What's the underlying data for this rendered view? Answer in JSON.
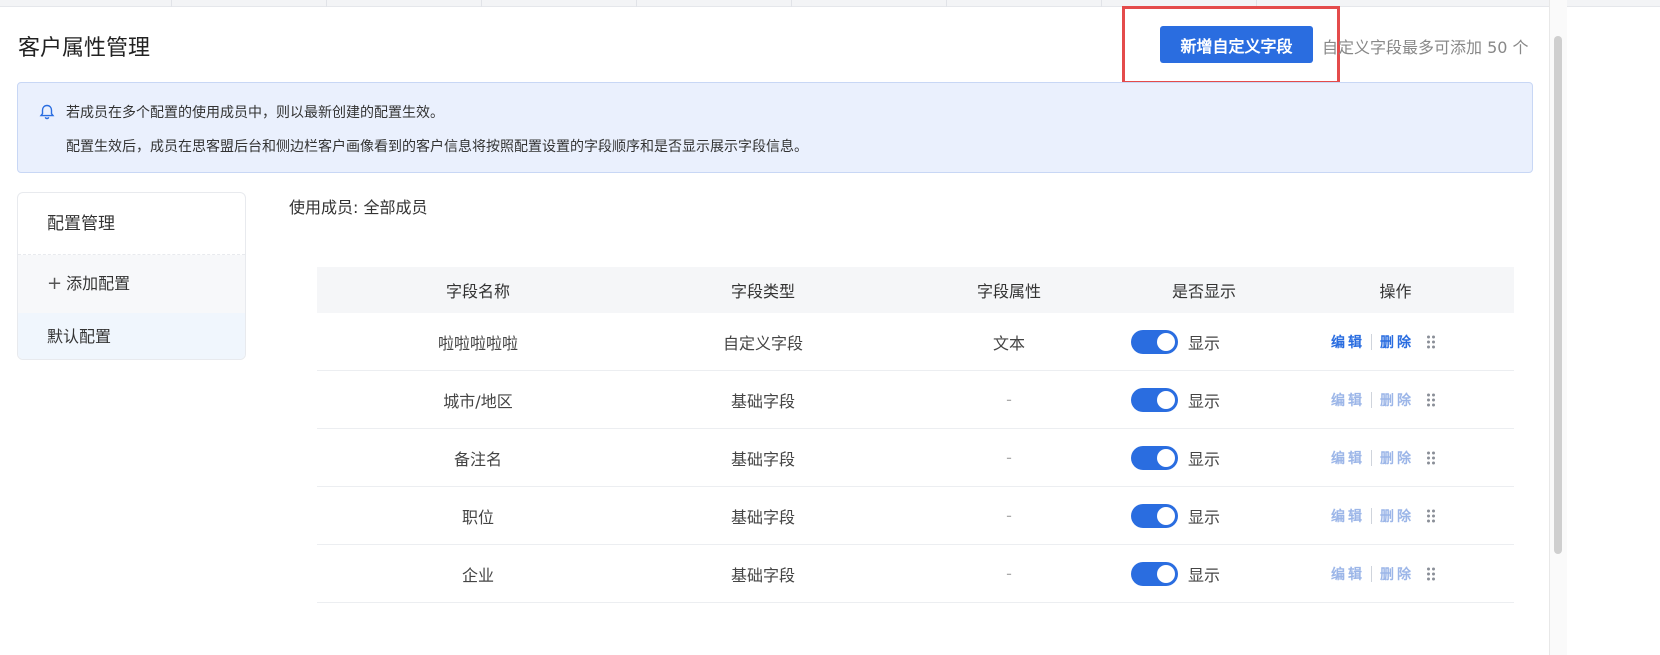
{
  "header": {
    "title": "客户属性管理",
    "add_button": "新增自定义字段",
    "limit_text": "自定义字段最多可添加 50 个"
  },
  "notice": {
    "icon": "bell-icon",
    "line1": "若成员在多个配置的使用成员中，则以最新创建的配置生效。",
    "line2": "配置生效后，成员在思客盟后台和侧边栏客户画像看到的客户信息将按照配置设置的字段顺序和是否显示展示字段信息。"
  },
  "sidebar": {
    "heading": "配置管理",
    "add_label": "添加配置",
    "items": [
      {
        "label": "默认配置"
      }
    ]
  },
  "members": "使用成员: 全部成员",
  "table": {
    "columns": [
      "字段名称",
      "字段类型",
      "字段属性",
      "是否显示",
      "操作"
    ],
    "rows": [
      {
        "name": "啦啦啦啦啦",
        "type": "自定义字段",
        "attr": "文本",
        "show": true,
        "show_label": "显示",
        "edit": "编辑",
        "delete": "删除",
        "editable": true
      },
      {
        "name": "城市/地区",
        "type": "基础字段",
        "attr": "-",
        "show": true,
        "show_label": "显示",
        "edit": "编辑",
        "delete": "删除",
        "editable": false
      },
      {
        "name": "备注名",
        "type": "基础字段",
        "attr": "-",
        "show": true,
        "show_label": "显示",
        "edit": "编辑",
        "delete": "删除",
        "editable": false
      },
      {
        "name": "职位",
        "type": "基础字段",
        "attr": "-",
        "show": true,
        "show_label": "显示",
        "edit": "编辑",
        "delete": "删除",
        "editable": false
      },
      {
        "name": "企业",
        "type": "基础字段",
        "attr": "-",
        "show": true,
        "show_label": "显示",
        "edit": "编辑",
        "delete": "删除",
        "editable": false
      }
    ]
  },
  "colors": {
    "primary": "#2a6de0",
    "primary_light": "#9cb6e8",
    "highlight_border": "#e44b4b",
    "notice_bg": "#eaf0fd"
  }
}
